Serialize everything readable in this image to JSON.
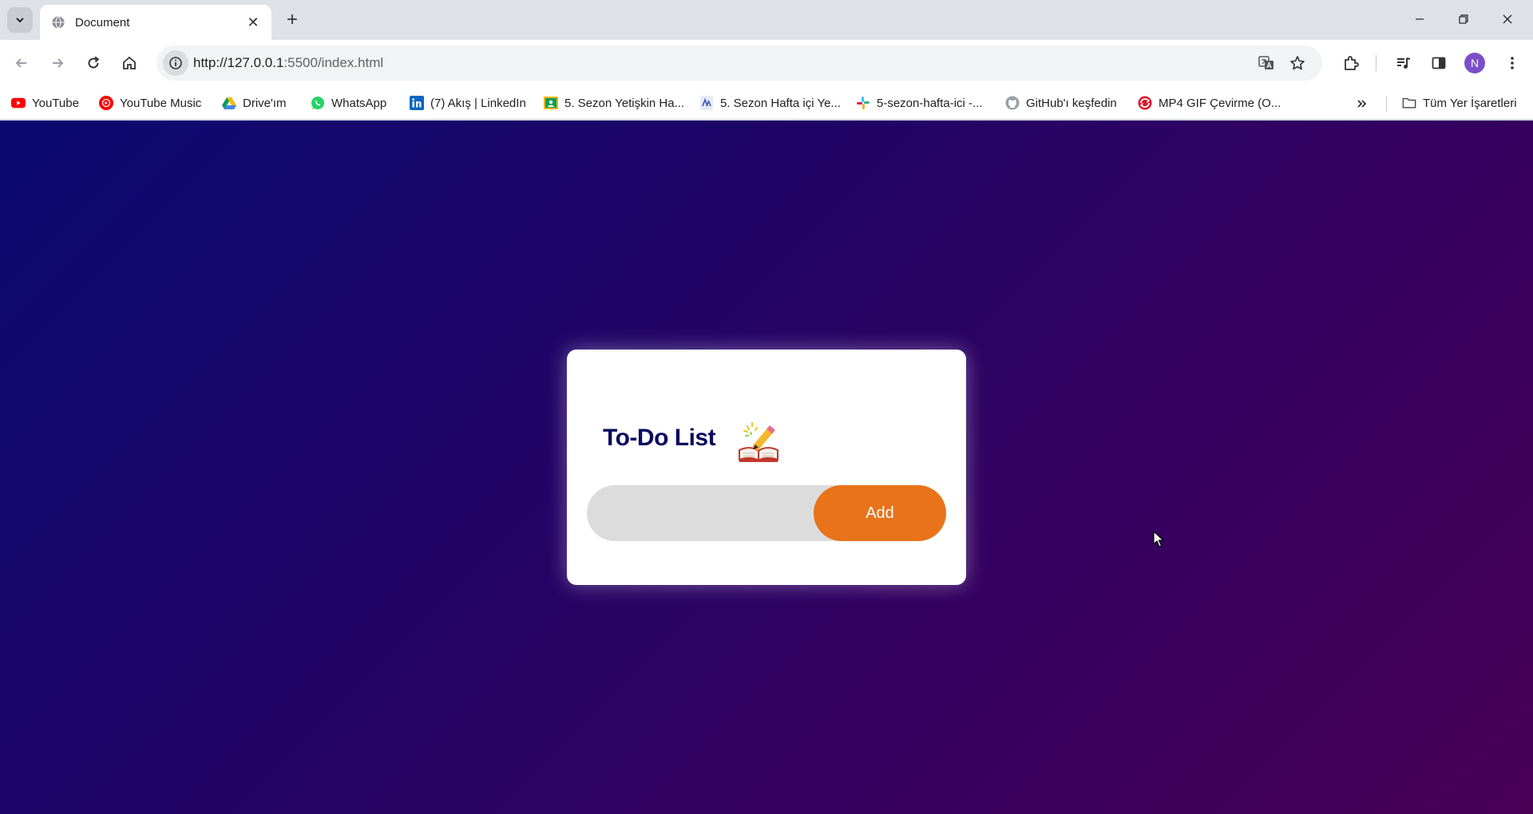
{
  "browser": {
    "tab": {
      "title": "Document"
    },
    "url": {
      "host": "http://127.0.0.1",
      "path": ":5500/index.html"
    },
    "profile_initial": "N"
  },
  "bookmarks": {
    "items": [
      {
        "label": "YouTube",
        "icon": "youtube-icon"
      },
      {
        "label": "YouTube Music",
        "icon": "youtube-music-icon"
      },
      {
        "label": "Drive'ım",
        "icon": "google-drive-icon"
      },
      {
        "label": "WhatsApp",
        "icon": "whatsapp-icon"
      },
      {
        "label": "(7) Akış | LinkedIn",
        "icon": "linkedin-icon"
      },
      {
        "label": "5. Sezon Yetişkin Ha...",
        "icon": "classroom-icon"
      },
      {
        "label": "5. Sezon Hafta içi Ye...",
        "icon": "doc-icon"
      },
      {
        "label": "5-sezon-hafta-ici -...",
        "icon": "slack-icon"
      },
      {
        "label": "GitHub'ı keşfedin",
        "icon": "github-icon"
      },
      {
        "label": "MP4 GIF Çevirme (O...",
        "icon": "converter-icon"
      }
    ],
    "all_bookmarks": "Tüm Yer İşaretleri"
  },
  "app": {
    "title": "To-Do List",
    "emoji": "📝",
    "input": {
      "placeholder": "",
      "value": ""
    },
    "add_label": "Add"
  },
  "colors": {
    "accent": "#e8731a",
    "title_color": "#0b0a5e",
    "background_start": "#0b0a70",
    "background_end": "#4a0055"
  }
}
